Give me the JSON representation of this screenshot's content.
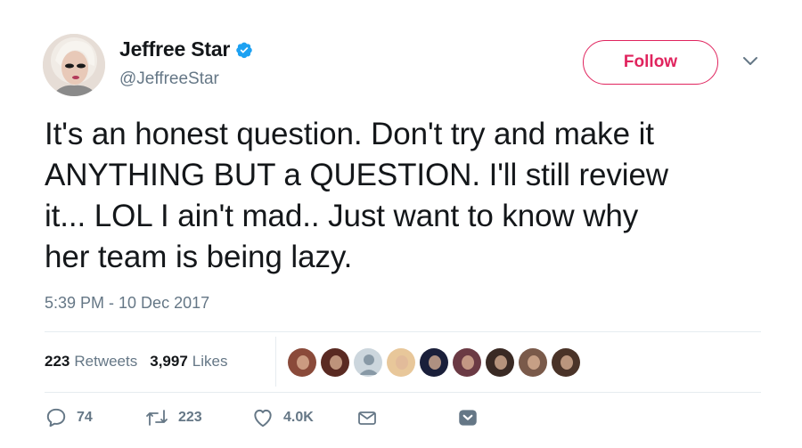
{
  "user": {
    "display_name": "Jeffree Star",
    "handle": "@JeffreeStar",
    "verified": true,
    "avatar_icon": "profile-photo"
  },
  "follow_button": {
    "label": "Follow",
    "color": "#e0245e"
  },
  "menu_icon": "chevron-down-icon",
  "tweet": {
    "text": "It's an honest question. Don't try and make it\nANYTHING BUT a QUESTION. I'll still review\nit... LOL I ain't mad.. Just want to know why\nher team is being lazy.",
    "timestamp": "5:39 PM - 10 Dec 2017"
  },
  "stats": {
    "retweets_count": "223",
    "retweets_label": "Retweets",
    "likes_count": "3,997",
    "likes_label": "Likes"
  },
  "liker_avatars": [
    {
      "color": "#8a4a3a"
    },
    {
      "color": "#5a2a22"
    },
    {
      "color": "#aab8c2"
    },
    {
      "color": "#e8c79a"
    },
    {
      "color": "#1a1f3a"
    },
    {
      "color": "#6b3a44"
    },
    {
      "color": "#3a2a24"
    },
    {
      "color": "#7a5a4a"
    },
    {
      "color": "#4a3328"
    }
  ],
  "actions": {
    "reply_count": "74",
    "retweet_count": "223",
    "like_count": "4.0K"
  },
  "colors": {
    "text": "#14171a",
    "secondary": "#657786",
    "verified": "#1da1f2",
    "divider": "#e6ecf0"
  }
}
